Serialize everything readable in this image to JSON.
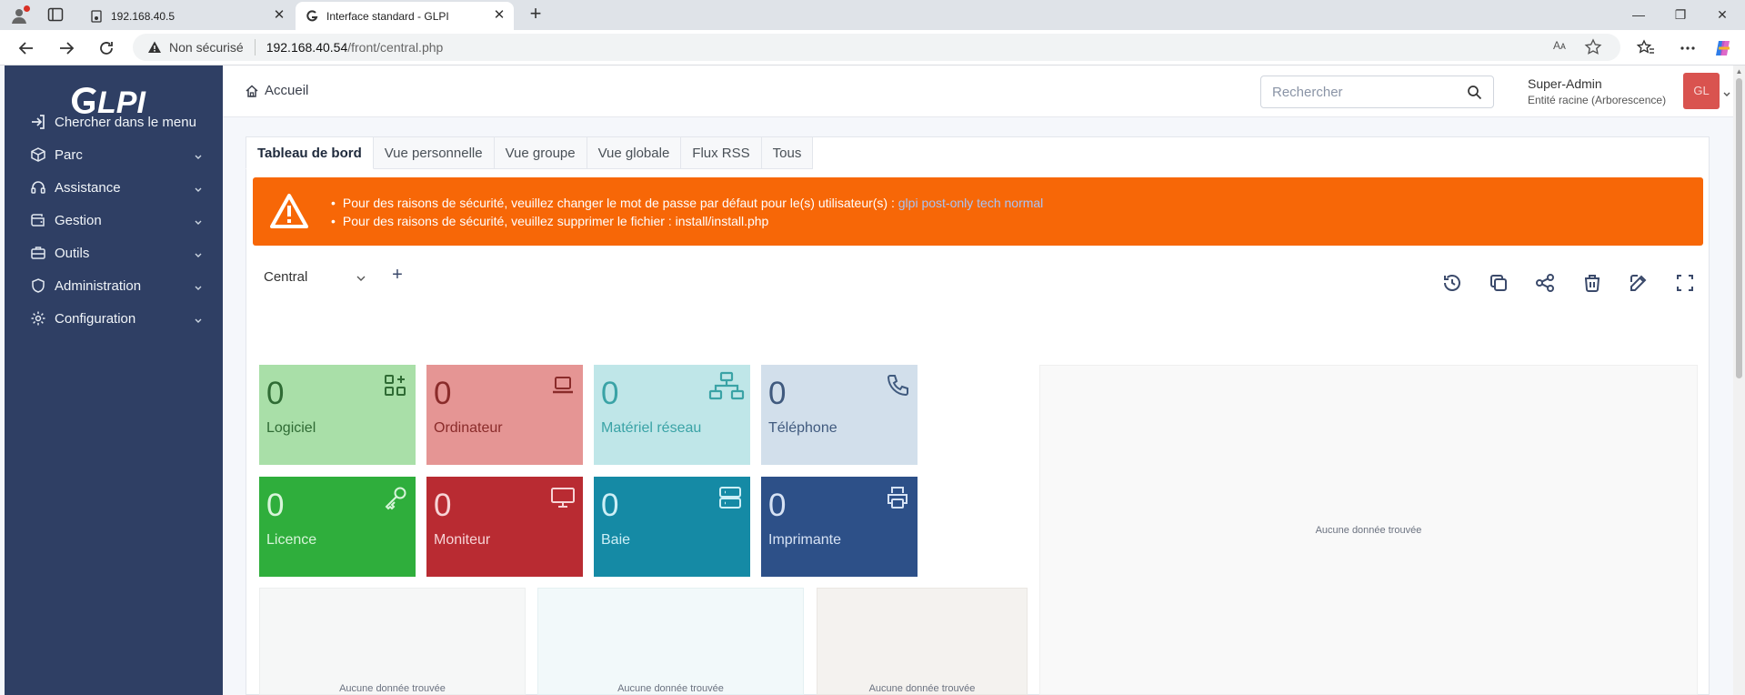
{
  "browser": {
    "tabs": [
      {
        "title": "192.168.40.5"
      },
      {
        "title": "Interface standard - GLPI"
      }
    ],
    "security_label": "Non sécurisé",
    "url_host": "192.168.40.54",
    "url_path": "/front/central.php",
    "reader_label": "Aᴀ"
  },
  "sidebar": {
    "items": [
      {
        "label": "Chercher dans le menu",
        "icon": "sign-in-icon"
      },
      {
        "label": "Parc",
        "icon": "box-icon"
      },
      {
        "label": "Assistance",
        "icon": "headset-icon"
      },
      {
        "label": "Gestion",
        "icon": "wallet-icon"
      },
      {
        "label": "Outils",
        "icon": "briefcase-icon"
      },
      {
        "label": "Administration",
        "icon": "shield-icon"
      },
      {
        "label": "Configuration",
        "icon": "gear-icon"
      }
    ]
  },
  "header": {
    "breadcrumb": "Accueil",
    "search_placeholder": "Rechercher",
    "user_name": "Super-Admin",
    "user_entity": "Entité racine (Arborescence)",
    "avatar_initials": "GL"
  },
  "tabs": [
    "Tableau de bord",
    "Vue personnelle",
    "Vue groupe",
    "Vue globale",
    "Flux RSS",
    "Tous"
  ],
  "alert": {
    "line1_prefix": "Pour des raisons de sécurité, veuillez changer le mot de passe par défaut pour le(s) utilisateur(s) : ",
    "line1_users": "glpi post-only tech normal",
    "line2": "Pour des raisons de sécurité, veuillez supprimer le fichier : install/install.php"
  },
  "dashboard": {
    "selected": "Central",
    "add_label": "+"
  },
  "tiles": [
    {
      "count": "0",
      "label": "Logiciel",
      "bg": "#a9dfa8",
      "fg": "#2f6b34"
    },
    {
      "count": "0",
      "label": "Ordinateur",
      "bg": "#e59594",
      "fg": "#8a2b2a"
    },
    {
      "count": "0",
      "label": "Matériel réseau",
      "bg": "#bfe6e8",
      "fg": "#3aa3a6"
    },
    {
      "count": "0",
      "label": "Téléphone",
      "bg": "#d2dfeb",
      "fg": "#405a7e"
    },
    {
      "count": "0",
      "label": "Licence",
      "bg": "#2fae3c",
      "fg": "#d8f5da"
    },
    {
      "count": "0",
      "label": "Moniteur",
      "bg": "#b92b32",
      "fg": "#f7d4d6"
    },
    {
      "count": "0",
      "label": "Baie",
      "bg": "#158aa5",
      "fg": "#cdeff6"
    },
    {
      "count": "0",
      "label": "Imprimante",
      "bg": "#2d5088",
      "fg": "#d6e2f4"
    }
  ],
  "panels": {
    "nodata": "Aucune donnée trouvée"
  }
}
